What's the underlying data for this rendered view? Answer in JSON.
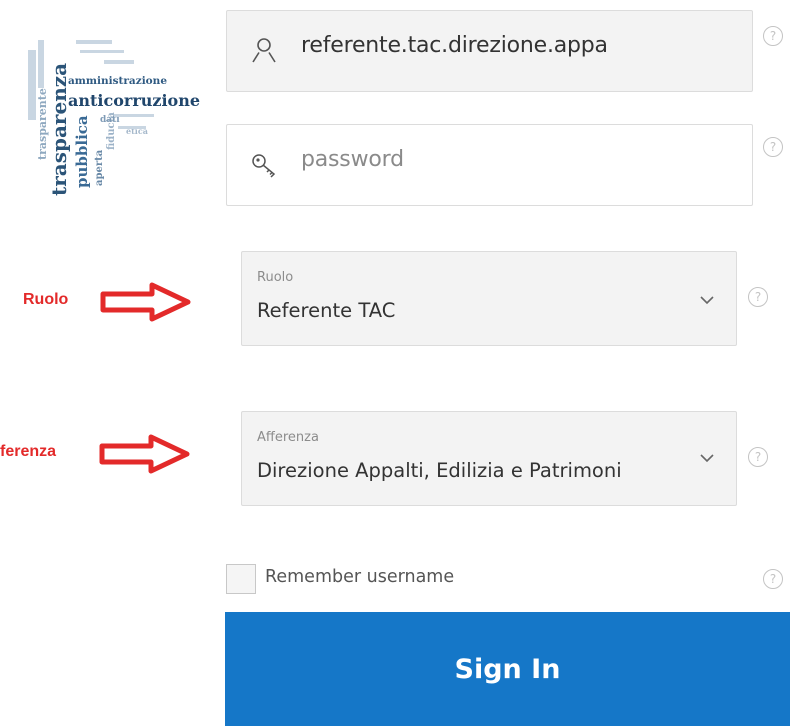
{
  "logo": {
    "icon": "word-cloud-logo",
    "words": [
      "trasparenza",
      "amministrazione",
      "anticorruzione",
      "pubblica",
      "aperta",
      "fiducia",
      "dati",
      "etica",
      "trasparente"
    ]
  },
  "username": {
    "icon": "user-icon",
    "value": "referente.tac.direzione.appa"
  },
  "password": {
    "icon": "key-icon",
    "placeholder": "password"
  },
  "ruolo": {
    "annotation": "Ruolo",
    "label": "Ruolo",
    "value": "Referente TAC"
  },
  "afferenza": {
    "annotation": "ferenza",
    "label": "Afferenza",
    "value": "Direzione Appalti, Edilizia e Patrimoni"
  },
  "remember": {
    "label": "Remember username",
    "checked": false
  },
  "help_glyph": "?",
  "sign_in": {
    "label": "Sign In"
  },
  "colors": {
    "primary": "#1577c8",
    "annotation": "#e32a2a",
    "field_bg": "#f3f3f3",
    "logo_blue": "#2b4e73"
  }
}
